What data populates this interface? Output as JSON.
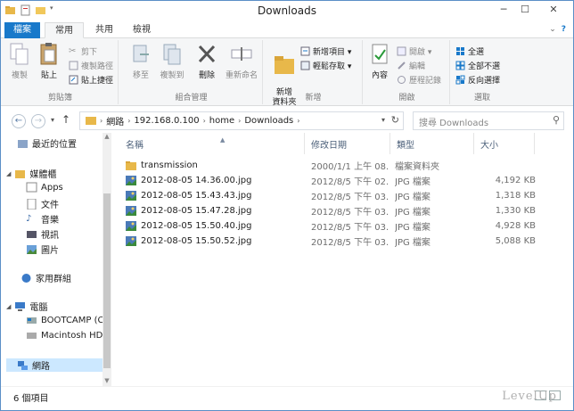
{
  "window": {
    "title": "Downloads"
  },
  "window_controls": {
    "minimize": "─",
    "maximize": "☐",
    "close": "✕"
  },
  "ribbon_tabs": {
    "file": "檔案",
    "home": "常用",
    "share": "共用",
    "view": "檢視"
  },
  "ribbon_help": {
    "expand": "⌄",
    "help": "?"
  },
  "ribbon": {
    "clipboard": {
      "label": "剪貼簿",
      "copy": "複製",
      "paste": "貼上",
      "cut": "剪下",
      "copy_path": "複製路徑",
      "paste_shortcut": "貼上捷徑"
    },
    "organize": {
      "label": "組合管理",
      "move_to": "移至",
      "copy_to": "複製到",
      "delete": "刪除",
      "rename": "重新命名"
    },
    "new": {
      "label": "新增",
      "new_folder": "新增\n資料夾",
      "new_item": "新增項目 ▾",
      "easy_access": "輕鬆存取 ▾"
    },
    "open": {
      "label": "開啟",
      "properties": "內容",
      "open": "開啟 ▾",
      "edit": "編輯",
      "history": "歷程記錄"
    },
    "select": {
      "label": "選取",
      "select_all": "全選",
      "select_none": "全部不選",
      "invert": "反向選擇"
    }
  },
  "navigation": {
    "back": "←",
    "forward": "→",
    "recent": "▾",
    "up": "↑"
  },
  "address": {
    "crumbs": [
      "網路",
      "192.168.0.100",
      "home",
      "Downloads"
    ],
    "sep": "›"
  },
  "search": {
    "placeholder": "搜尋 Downloads"
  },
  "nav_pane": {
    "recent": "最近的位置",
    "libraries": "媒體櫃",
    "apps": "Apps",
    "documents": "文件",
    "music": "音樂",
    "videos": "視訊",
    "pictures": "圖片",
    "homegroup": "家用群組",
    "computer": "電腦",
    "bootcamp": "BOOTCAMP (C",
    "macintosh": "Macintosh HD",
    "network": "網路"
  },
  "columns": {
    "name": "名稱",
    "date": "修改日期",
    "type": "類型",
    "size": "大小"
  },
  "files": [
    {
      "name": "transmission",
      "date": "2000/1/1 上午 08...",
      "type": "檔案資料夾",
      "size": "",
      "kind": "folder"
    },
    {
      "name": "2012-08-05 14.36.00.jpg",
      "date": "2012/8/5 下午 02...",
      "type": "JPG 檔案",
      "size": "4,192 KB",
      "kind": "image"
    },
    {
      "name": "2012-08-05 15.43.43.jpg",
      "date": "2012/8/5 下午 03...",
      "type": "JPG 檔案",
      "size": "1,318 KB",
      "kind": "image"
    },
    {
      "name": "2012-08-05 15.47.28.jpg",
      "date": "2012/8/5 下午 03...",
      "type": "JPG 檔案",
      "size": "1,330 KB",
      "kind": "image"
    },
    {
      "name": "2012-08-05 15.50.40.jpg",
      "date": "2012/8/5 下午 03...",
      "type": "JPG 檔案",
      "size": "4,928 KB",
      "kind": "image"
    },
    {
      "name": "2012-08-05 15.50.52.jpg",
      "date": "2012/8/5 下午 03...",
      "type": "JPG 檔案",
      "size": "5,088 KB",
      "kind": "image"
    }
  ],
  "status": {
    "item_count": "6 個項目"
  },
  "watermark": "LevelUp",
  "colors": {
    "accent": "#1979ca",
    "selection": "#cce8ff",
    "folder": "#e8b84a"
  }
}
